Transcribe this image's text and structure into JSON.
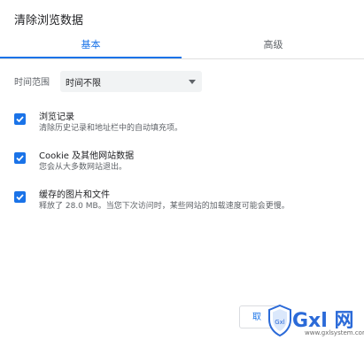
{
  "dialog": {
    "title": "清除浏览数据"
  },
  "tabs": [
    {
      "label": "基本"
    },
    {
      "label": "高级"
    }
  ],
  "time_range": {
    "label": "时间范围",
    "selected": "时间不限"
  },
  "items": [
    {
      "title": "浏览记录",
      "description": "清除历史记录和地址栏中的自动填充项。",
      "checked": true
    },
    {
      "title": "Cookie 及其他网站数据",
      "description": "您会从大多数网站退出。",
      "checked": true
    },
    {
      "title": "缓存的图片和文件",
      "description": "释放了 28.0 MB。当您下次访问时，某些网站的加载速度可能会更慢。",
      "checked": true
    }
  ],
  "footer": {
    "cancel_label": "取"
  },
  "watermark": {
    "logo_text": "Gxl 网",
    "shield_text": "Gxl",
    "url": "www.gxlsystem.com"
  },
  "colors": {
    "accent": "#1a73e8",
    "text": "#202124",
    "secondary_text": "#5f6368"
  }
}
